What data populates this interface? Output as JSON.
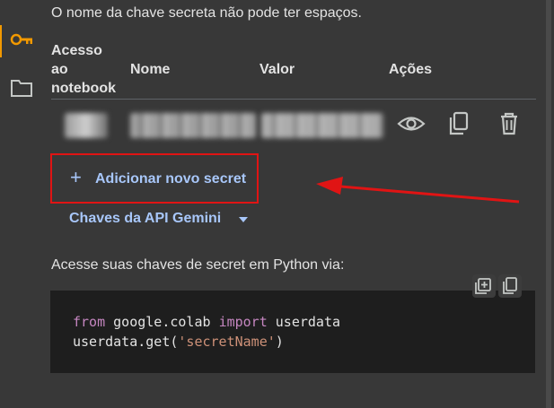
{
  "hint": "O nome da chave secreta não pode ter espaços.",
  "table": {
    "headers": {
      "access": "Acesso ao notebook",
      "name": "Nome",
      "value": "Valor",
      "actions": "Ações"
    }
  },
  "add_button": {
    "plus": "+",
    "label": "Adicionar novo secret"
  },
  "gemini": {
    "label": "Chaves da API Gemini"
  },
  "access_text": "Acesse suas chaves de secret em Python via:",
  "code": {
    "line1_kw1": "from",
    "line1_mod": " google.colab ",
    "line1_kw2": "import",
    "line1_name": " userdata",
    "line2_pre": "userdata.get(",
    "line2_str": "'secretName'",
    "line2_post": ")"
  },
  "colors": {
    "accent": "#a8c7fa",
    "highlight_box": "#e01414",
    "active_rail": "#f29900",
    "background": "#383838",
    "code_background": "#1e1e1e"
  },
  "icons": {
    "rail": [
      "key-icon",
      "folder-icon"
    ],
    "actions": [
      "eye-icon",
      "copy-icon",
      "delete-icon"
    ],
    "code": [
      "insert-icon",
      "copy-code-icon"
    ]
  }
}
